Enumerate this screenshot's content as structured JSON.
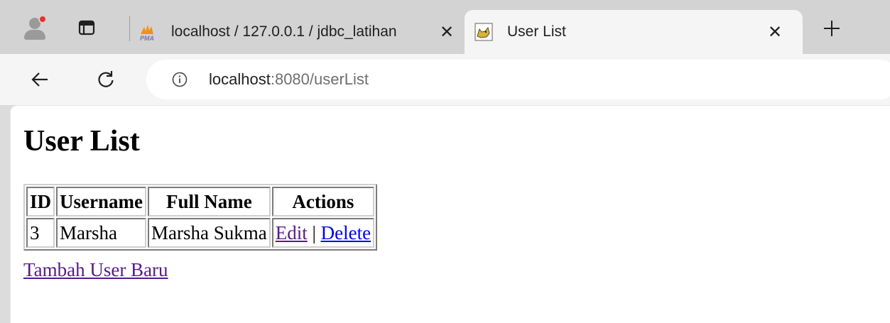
{
  "browser": {
    "tabs": [
      {
        "title": "localhost / 127.0.0.1 / jdbc_latihan",
        "favicon": "phpmyadmin-icon",
        "active": false
      },
      {
        "title": "User List",
        "favicon": "tomcat-icon",
        "active": true
      }
    ],
    "close_glyph": "✕",
    "address": {
      "host": "localhost",
      "rest": ":8080/userList"
    }
  },
  "page": {
    "title": "User List",
    "table": {
      "headers": [
        "ID",
        "Username",
        "Full Name",
        "Actions"
      ],
      "rows": [
        {
          "id": "3",
          "username": "Marsha",
          "full_name": "Marsha Sukma",
          "edit_label": "Edit",
          "separator": " | ",
          "delete_label": "Delete"
        }
      ]
    },
    "add_link": "Tambah User Baru"
  },
  "colors": {
    "visited_link": "#551a8b",
    "link": "#0000ee",
    "tab_strip": "#d3d3d3",
    "toolbar": "#f5f5f5"
  }
}
